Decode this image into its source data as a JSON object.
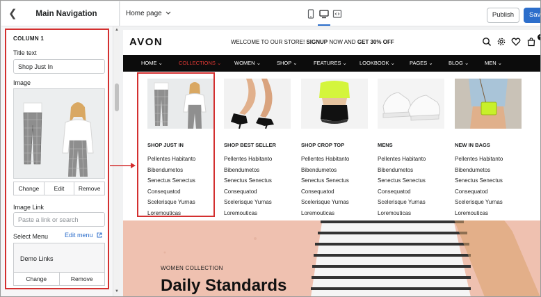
{
  "editor": {
    "panel_title": "Main Navigation",
    "section_title": "COLUMN 1",
    "title_text_label": "Title text",
    "title_text_value": "Shop Just In",
    "image_label": "Image",
    "image_buttons": [
      "Change",
      "Edit",
      "Remove"
    ],
    "image_link_label": "Image Link",
    "image_link_placeholder": "Paste a link or search",
    "select_menu_label": "Select Menu",
    "edit_menu_label": "Edit menu",
    "menu_name": "Demo Links",
    "menu_buttons": [
      "Change",
      "Remove"
    ]
  },
  "topbar": {
    "page_select": "Home page",
    "publish_label": "Publish",
    "save_label": "Save",
    "active_device": "desktop"
  },
  "store": {
    "logo": "AVON",
    "welcome_pre": "WELCOME TO OUR STORE! ",
    "welcome_signup": "SIGNUP",
    "welcome_mid": " NOW AND ",
    "welcome_offer": "GET 30% OFF",
    "cart_count": "4",
    "nav": [
      "HOME",
      "COLLECTIONS",
      "WOMEN",
      "SHOP",
      "FEATURES",
      "LOOKBOOK",
      "PAGES",
      "BLOG",
      "MEN"
    ],
    "active_nav": "COLLECTIONS",
    "mega_columns": [
      {
        "title": "SHOP JUST IN",
        "links": [
          "Pellentes Habitanto",
          "Bibendumetos",
          "Senectus Senectus",
          "Consequatod",
          "Scelerisque Yurnas",
          "Loremouticas"
        ]
      },
      {
        "title": "SHOP BEST SELLER",
        "links": [
          "Pellentes Habitanto",
          "Bibendumetos",
          "Senectus Senectus",
          "Consequatod",
          "Scelerisque Yurnas",
          "Loremouticas"
        ]
      },
      {
        "title": "SHOP CROP TOP",
        "links": [
          "Pellentes Habitanto",
          "Bibendumetos",
          "Senectus Senectus",
          "Consequatod",
          "Scelerisque Yurnas",
          "Loremouticas"
        ]
      },
      {
        "title": "MENS",
        "links": [
          "Pellentes Habitanto",
          "Bibendumetos",
          "Senectus Senectus",
          "Consequatod",
          "Scelerisque Yurnas",
          "Loremouticas"
        ]
      },
      {
        "title": "NEW IN BAGS",
        "links": [
          "Pellentes Habitanto",
          "Bibendumetos",
          "Senectus Senectus",
          "Consequatod",
          "Scelerisque Yurnas",
          "Loremouticas"
        ]
      }
    ],
    "hero_label": "WOMEN COLLECTION",
    "hero_title": "Daily Standards"
  },
  "colors": {
    "accent": "#2c6ecb",
    "highlight": "#d32f2f",
    "nav_bg": "#0c0c0c",
    "nav_active": "#e53935",
    "hero_bg": "#f0c3b2"
  }
}
